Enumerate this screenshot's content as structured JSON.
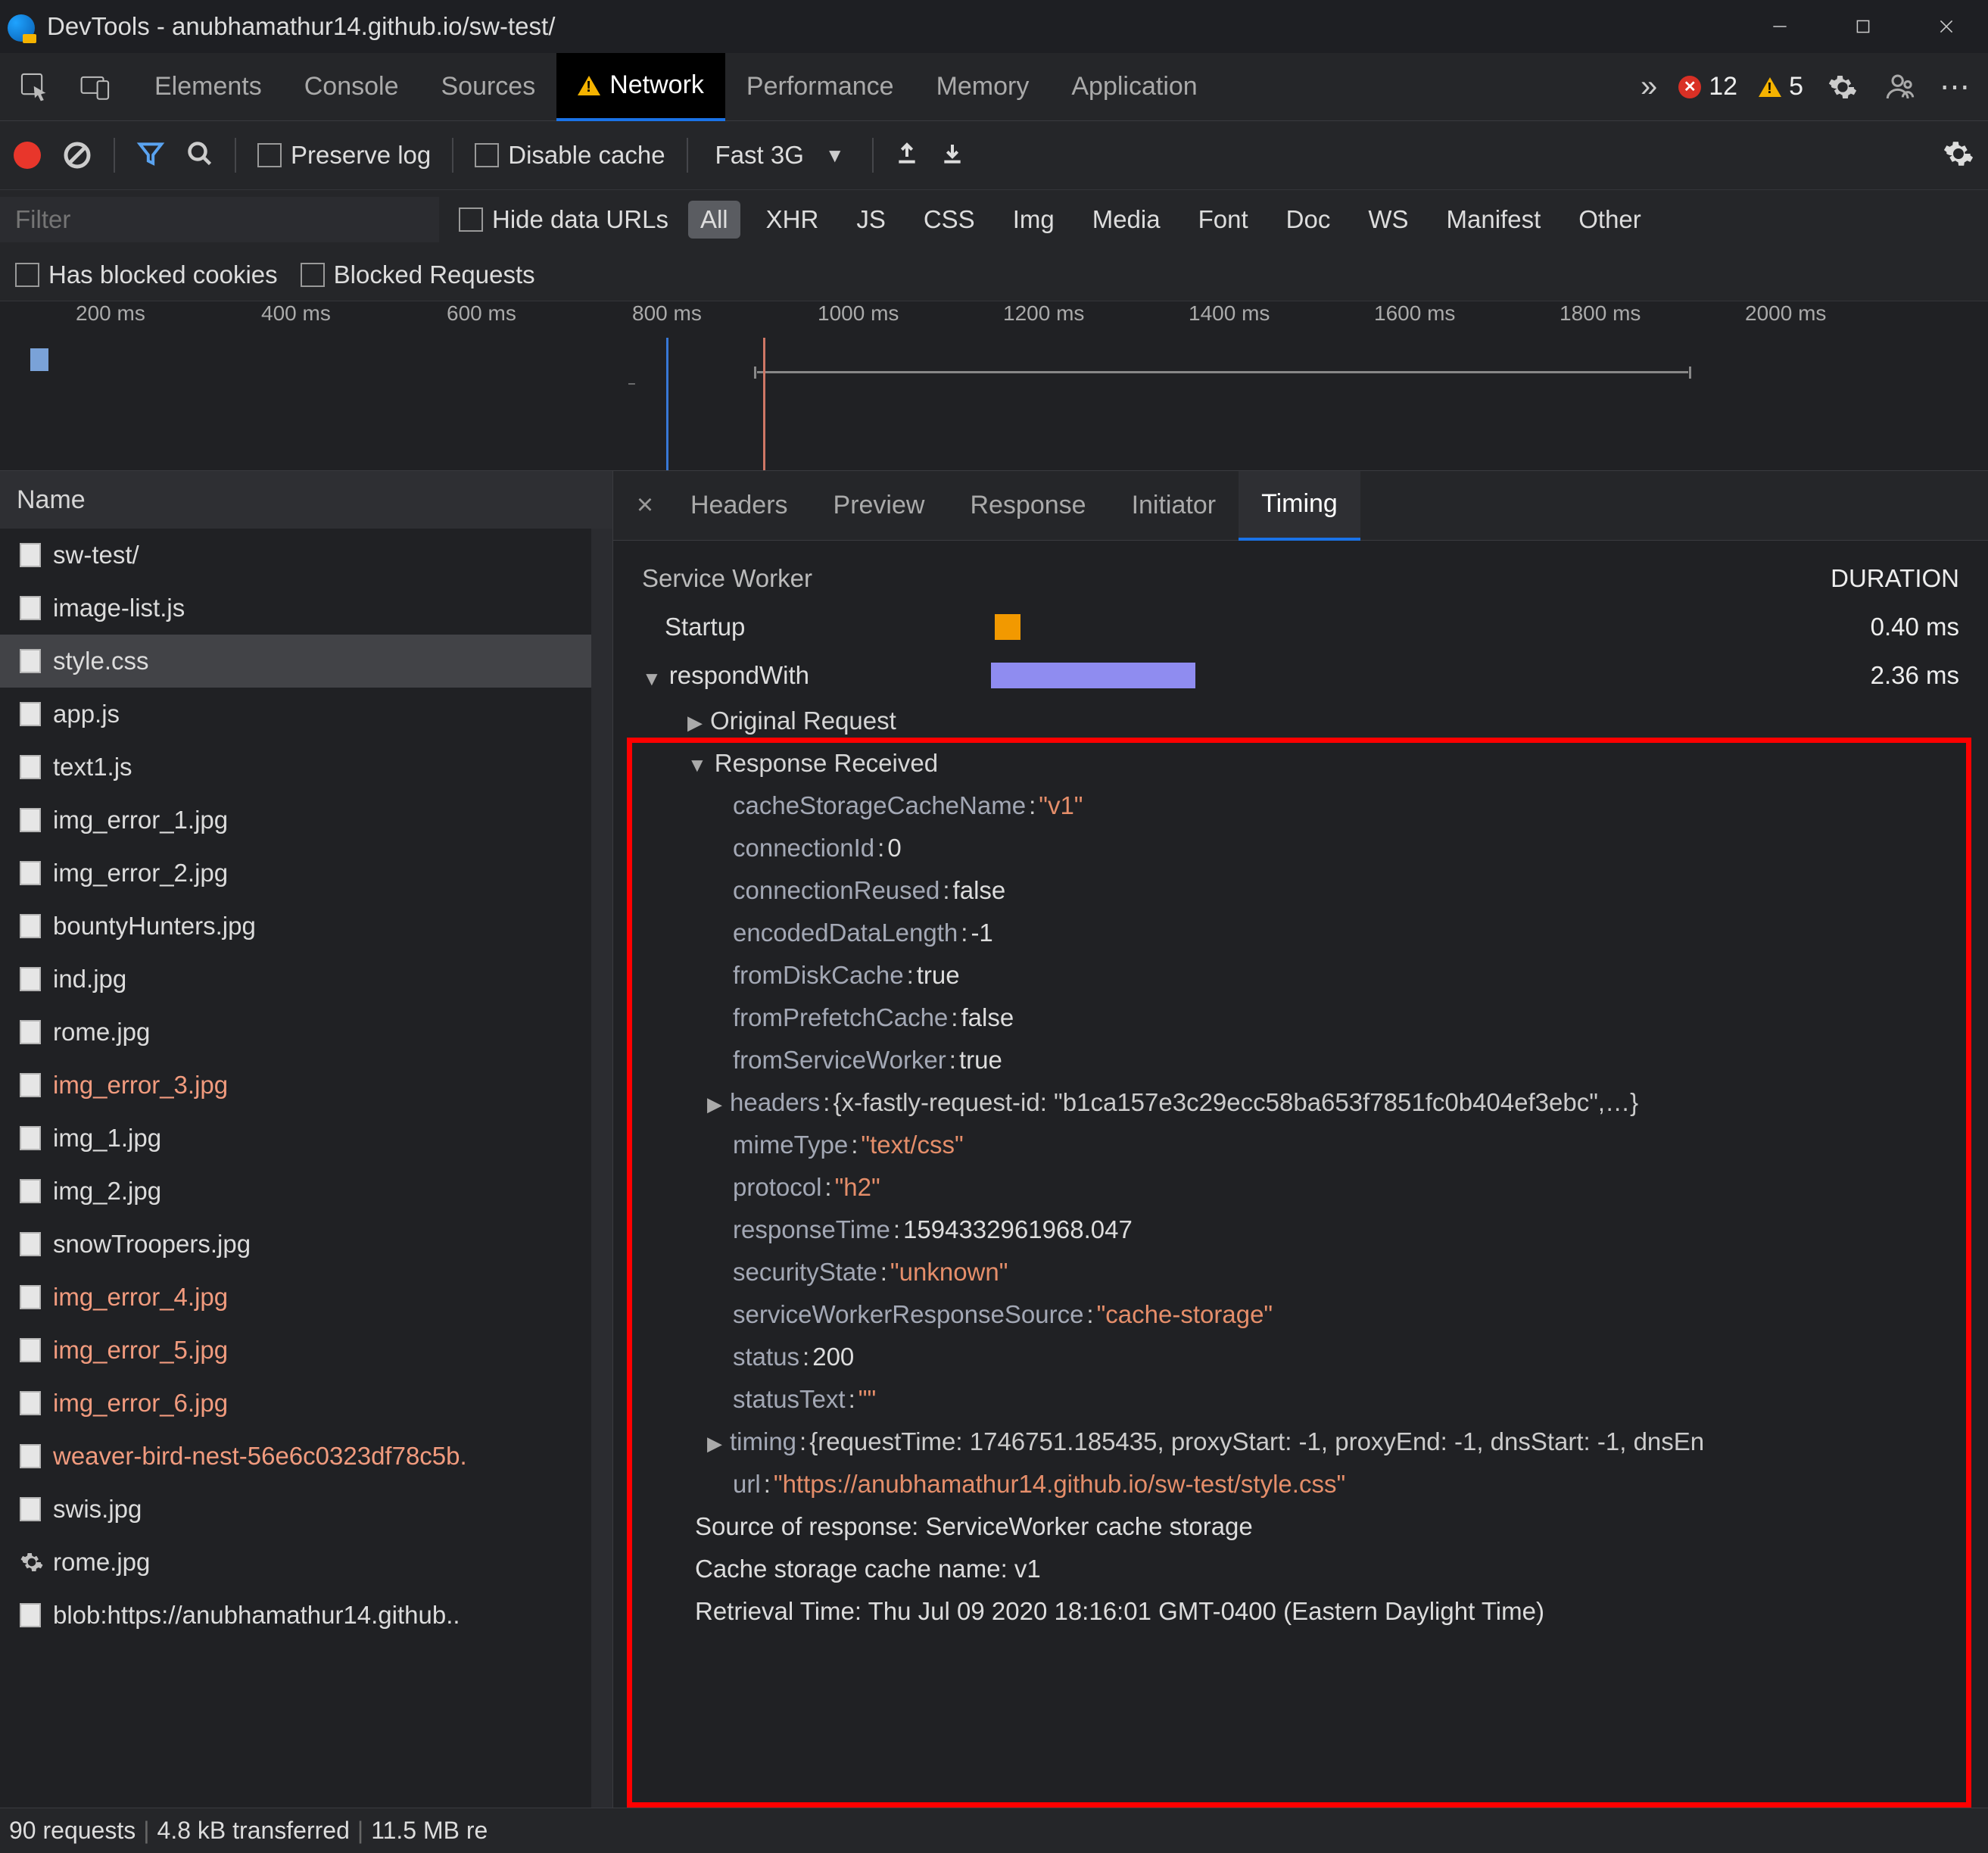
{
  "window": {
    "title": "DevTools - anubhamathur14.github.io/sw-test/"
  },
  "mainTabs": {
    "items": [
      "Elements",
      "Console",
      "Sources",
      "Network",
      "Performance",
      "Memory",
      "Application"
    ],
    "active": "Network",
    "overflow": "»",
    "errors": "12",
    "warnings": "5"
  },
  "toolbar": {
    "preserveLog": "Preserve log",
    "disableCache": "Disable cache",
    "throttling": "Fast 3G"
  },
  "filterBar": {
    "placeholder": "Filter",
    "hideData": "Hide data URLs",
    "types": [
      "All",
      "XHR",
      "JS",
      "CSS",
      "Img",
      "Media",
      "Font",
      "Doc",
      "WS",
      "Manifest",
      "Other"
    ],
    "activeType": "All",
    "hasBlocked": "Has blocked cookies",
    "blockedReq": "Blocked Requests"
  },
  "timeline": {
    "ticks": [
      "200 ms",
      "400 ms",
      "600 ms",
      "800 ms",
      "1000 ms",
      "1200 ms",
      "1400 ms",
      "1600 ms",
      "1800 ms",
      "2000 ms"
    ],
    "dash": "–"
  },
  "list": {
    "header": "Name",
    "selected": "style.css",
    "items": [
      {
        "name": "sw-test/",
        "err": false,
        "gear": false
      },
      {
        "name": "image-list.js",
        "err": false,
        "gear": false
      },
      {
        "name": "style.css",
        "err": false,
        "gear": false
      },
      {
        "name": "app.js",
        "err": false,
        "gear": false
      },
      {
        "name": "text1.js",
        "err": false,
        "gear": false
      },
      {
        "name": "img_error_1.jpg",
        "err": false,
        "gear": false
      },
      {
        "name": "img_error_2.jpg",
        "err": false,
        "gear": false
      },
      {
        "name": "bountyHunters.jpg",
        "err": false,
        "gear": false
      },
      {
        "name": "ind.jpg",
        "err": false,
        "gear": false
      },
      {
        "name": "rome.jpg",
        "err": false,
        "gear": false
      },
      {
        "name": "img_error_3.jpg",
        "err": true,
        "gear": false
      },
      {
        "name": "img_1.jpg",
        "err": false,
        "gear": false
      },
      {
        "name": "img_2.jpg",
        "err": false,
        "gear": false
      },
      {
        "name": "snowTroopers.jpg",
        "err": false,
        "gear": false
      },
      {
        "name": "img_error_4.jpg",
        "err": true,
        "gear": false
      },
      {
        "name": "img_error_5.jpg",
        "err": true,
        "gear": false
      },
      {
        "name": "img_error_6.jpg",
        "err": true,
        "gear": false
      },
      {
        "name": "weaver-bird-nest-56e6c0323df78c5b.",
        "err": true,
        "gear": false
      },
      {
        "name": "swis.jpg",
        "err": false,
        "gear": false
      },
      {
        "name": "rome.jpg",
        "err": false,
        "gear": true
      },
      {
        "name": "blob:https://anubhamathur14.github..",
        "err": false,
        "gear": false
      }
    ]
  },
  "detailTabs": {
    "items": [
      "Headers",
      "Preview",
      "Response",
      "Initiator",
      "Timing"
    ],
    "active": "Timing"
  },
  "timing": {
    "section": "Service Worker",
    "durationHdr": "DURATION",
    "rows": [
      {
        "label": "Startup",
        "dur": "0.40 ms",
        "color": "orange"
      },
      {
        "label": "respondWith",
        "dur": "2.36 ms",
        "color": "purple"
      }
    ],
    "origReq": "Original Request",
    "respRecv": "Response Received",
    "props": [
      {
        "k": "cacheStorageCacheName",
        "v": "\"v1\"",
        "t": "str"
      },
      {
        "k": "connectionId",
        "v": "0",
        "t": "num"
      },
      {
        "k": "connectionReused",
        "v": "false",
        "t": "bool"
      },
      {
        "k": "encodedDataLength",
        "v": "-1",
        "t": "num"
      },
      {
        "k": "fromDiskCache",
        "v": "true",
        "t": "bool"
      },
      {
        "k": "fromPrefetchCache",
        "v": "false",
        "t": "bool"
      },
      {
        "k": "fromServiceWorker",
        "v": "true",
        "t": "bool"
      },
      {
        "k": "headers",
        "v": "{x-fastly-request-id: \"b1ca157e3c29ecc58ba653f7851fc0b404ef3ebc\",…}",
        "t": "obj",
        "exp": true
      },
      {
        "k": "mimeType",
        "v": "\"text/css\"",
        "t": "str"
      },
      {
        "k": "protocol",
        "v": "\"h2\"",
        "t": "str"
      },
      {
        "k": "responseTime",
        "v": "1594332961968.047",
        "t": "num"
      },
      {
        "k": "securityState",
        "v": "\"unknown\"",
        "t": "str"
      },
      {
        "k": "serviceWorkerResponseSource",
        "v": "\"cache-storage\"",
        "t": "str"
      },
      {
        "k": "status",
        "v": "200",
        "t": "num"
      },
      {
        "k": "statusText",
        "v": "\"\"",
        "t": "str"
      },
      {
        "k": "timing",
        "v": "{requestTime: 1746751.185435, proxyStart: -1, proxyEnd: -1, dnsStart: -1, dnsEn",
        "t": "obj",
        "exp": true
      },
      {
        "k": "url",
        "v": "\"https://anubhamathur14.github.io/sw-test/style.css\"",
        "t": "str"
      }
    ],
    "src": "Source of response: ServiceWorker cache storage",
    "cacheName": "Cache storage cache name: v1",
    "retrieval": "Retrieval Time: Thu Jul 09 2020 18:16:01 GMT-0400 (Eastern Daylight Time)"
  },
  "status": {
    "requests": "90 requests",
    "transferred": "4.8 kB transferred",
    "resources": "11.5 MB re"
  }
}
